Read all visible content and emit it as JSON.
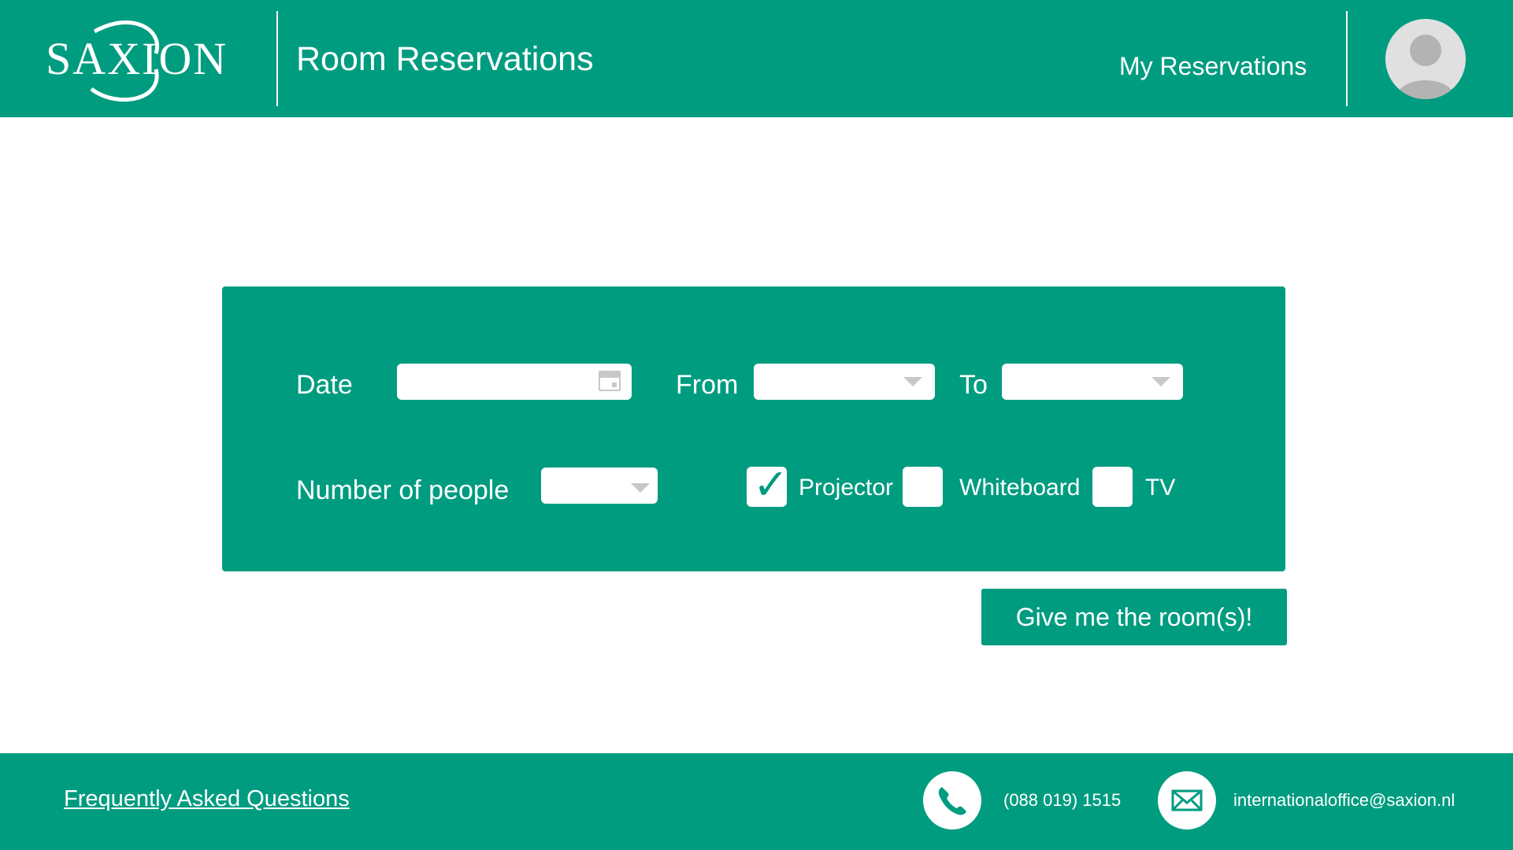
{
  "header": {
    "logo_text": "SAXION",
    "title": "Room Reservations",
    "nav_my_reservations": "My Reservations",
    "avatar_icon": "user-avatar-icon"
  },
  "form": {
    "date_label": "Date",
    "date_value": "",
    "from_label": "From",
    "from_value": "",
    "to_label": "To",
    "to_value": "",
    "people_label": "Number of people",
    "people_value": "",
    "amenities": [
      {
        "label": "Projector",
        "checked": true
      },
      {
        "label": "Whiteboard",
        "checked": false
      },
      {
        "label": "TV",
        "checked": false
      }
    ],
    "check_glyph": "✓",
    "submit_label": "Give me the room(s)!"
  },
  "footer": {
    "faq_link": "Frequently Asked Questions",
    "phone_icon": "phone-icon",
    "phone": "(088 019) 1515",
    "email_icon": "envelope-icon",
    "email": "internationaloffice@saxion.nl"
  },
  "colors": {
    "brand_green": "#009c80",
    "white": "#ffffff",
    "placeholder_gray": "#c8c8c8"
  }
}
